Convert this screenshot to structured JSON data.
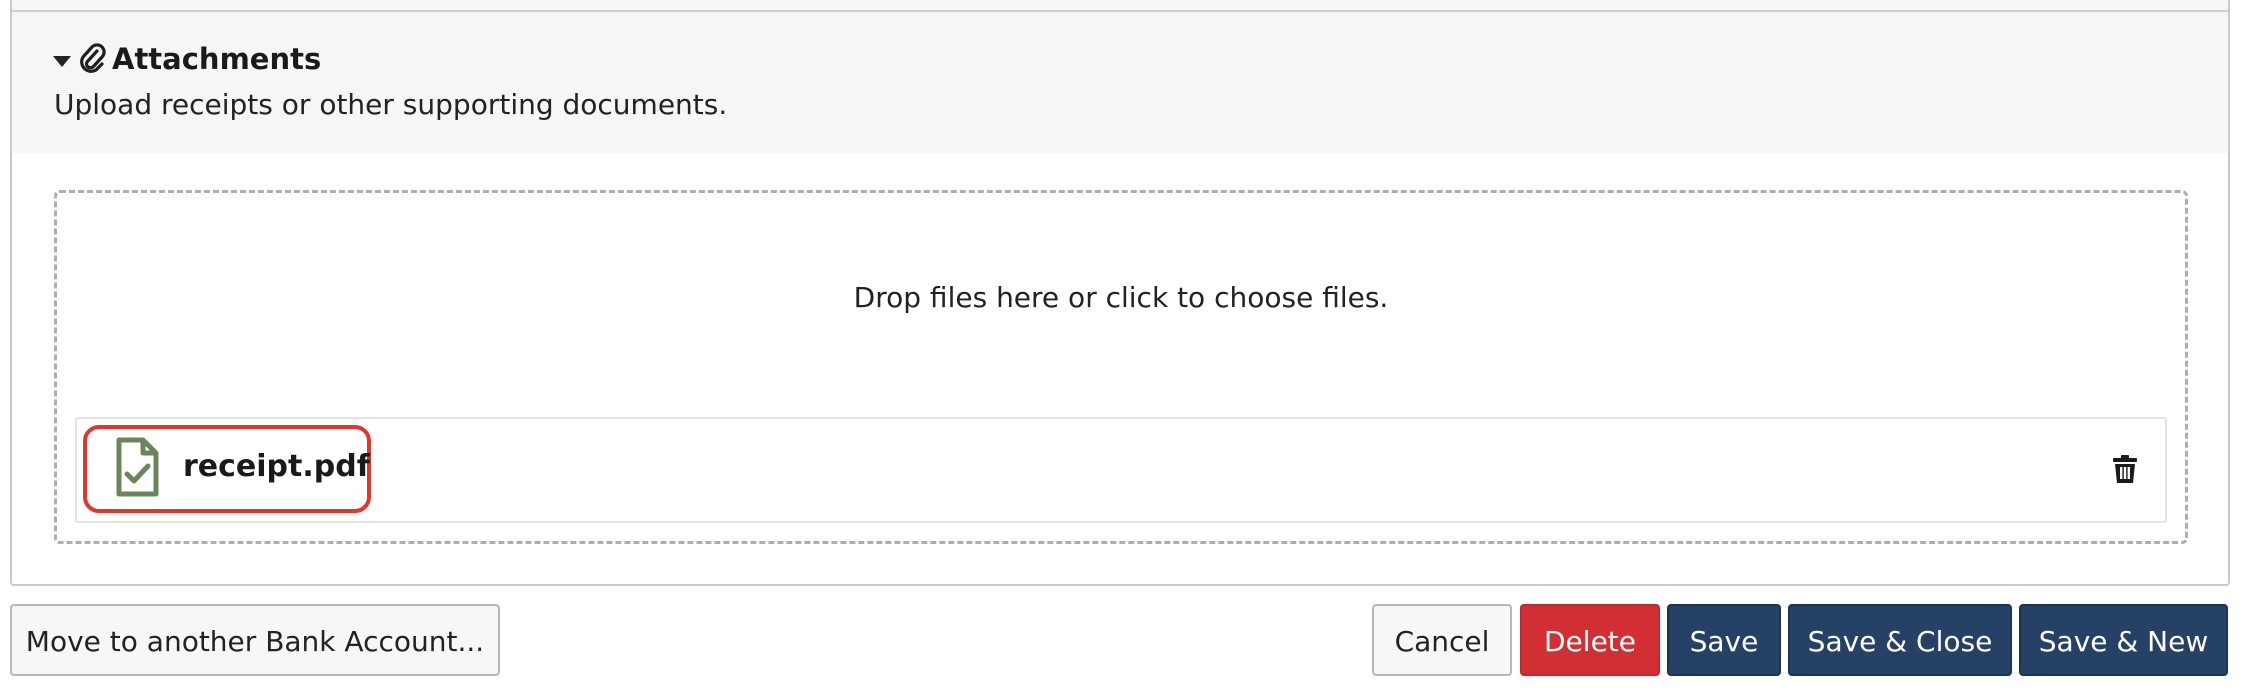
{
  "attachments": {
    "title": "Attachments",
    "description": "Upload receipts or other supporting documents.",
    "dropzone_text": "Drop files here or click to choose files.",
    "files": [
      {
        "name": "receipt.pdf",
        "status": "uploaded"
      }
    ]
  },
  "actions": {
    "move": "Move to another Bank Account...",
    "cancel": "Cancel",
    "delete": "Delete",
    "save": "Save",
    "save_close": "Save & Close",
    "save_new": "Save & New"
  },
  "colors": {
    "primary": "#254165",
    "danger": "#d12f33",
    "file_icon": "#6b845a",
    "highlight": "#e4352a"
  },
  "icons": {
    "toggle": "caret-down-icon",
    "header": "paperclip-icon",
    "file": "file-check-icon",
    "remove": "trash-icon"
  }
}
